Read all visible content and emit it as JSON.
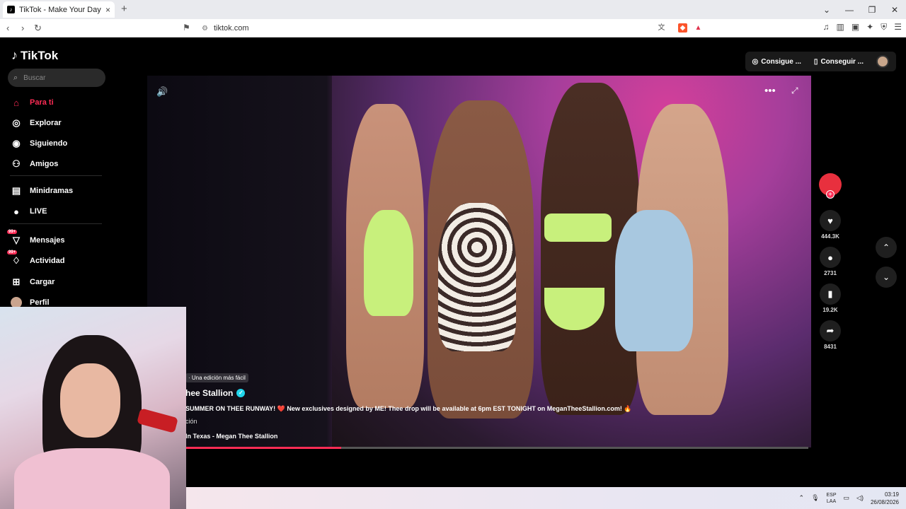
{
  "browser": {
    "tab_title": "TikTok - Make Your Day",
    "tab_close": "×",
    "new_tab": "+",
    "url": "tiktok.com",
    "window_controls": [
      "⌄",
      "—",
      "❐",
      "✕"
    ]
  },
  "app": {
    "logo_text": "TikTok",
    "search_placeholder": "Buscar",
    "nav": [
      {
        "label": "Para ti",
        "icon": "home-icon",
        "active": true
      },
      {
        "label": "Explorar",
        "icon": "compass-icon"
      },
      {
        "label": "Siguiendo",
        "icon": "following-icon"
      },
      {
        "label": "Amigos",
        "icon": "friends-icon"
      },
      {
        "label": "Minidramas",
        "icon": "film-icon"
      },
      {
        "label": "LIVE",
        "icon": "live-icon"
      },
      {
        "label": "Mensajes",
        "icon": "messages-icon",
        "badge": "99+"
      },
      {
        "label": "Actividad",
        "icon": "activity-icon",
        "badge": "99+"
      },
      {
        "label": "Cargar",
        "icon": "upload-icon"
      },
      {
        "label": "Perfil",
        "icon": "profile-icon"
      }
    ],
    "top_right": {
      "get_coins": "Consigue ...",
      "get_app": "Conseguir ..."
    },
    "video": {
      "edit_tag": "· Una edición más fácil",
      "author": "hee Stallion",
      "description": "SUMMER ON THEE RUNWAY! ❤️ New exclusives designed by ME! Thee drop will be available at 6pm EST TONIGHT on MeganTheeStallion.com! 🔥",
      "more": "ción",
      "music": "In Texas - Megan Thee Stallion",
      "progress": 0.25
    },
    "actions": {
      "likes": "444.3K",
      "comments": "2731",
      "saves": "19.2K",
      "shares": "8431"
    }
  },
  "taskbar": {
    "lang_top": "ESP",
    "lang_bottom": "LAA",
    "time": "03:19",
    "date": "26/08/2026"
  },
  "colors": {
    "accent": "#fe2c55",
    "background": "#000000"
  }
}
